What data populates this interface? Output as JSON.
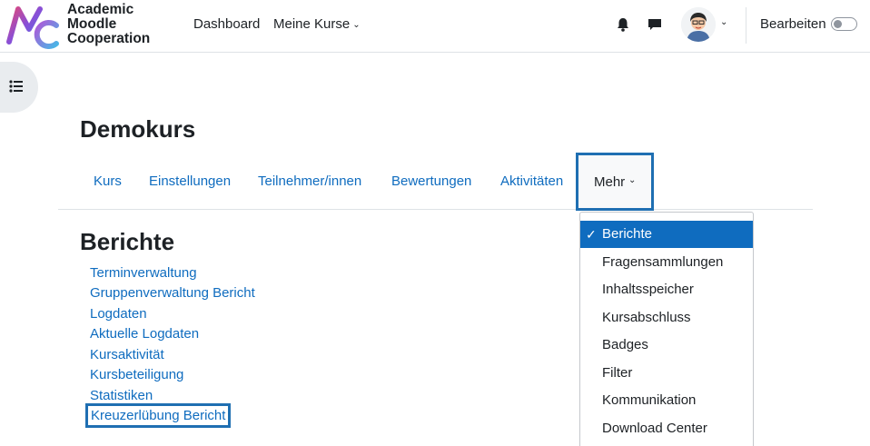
{
  "header": {
    "brand_lines": [
      "Academic",
      "Moodle",
      "Cooperation"
    ],
    "nav": [
      {
        "label": "Dashboard"
      },
      {
        "label": "Meine Kurse",
        "caret": "⌄"
      }
    ],
    "edit_mode_label": "Bearbeiten",
    "edit_mode_on": false
  },
  "course": {
    "title": "Demokurs"
  },
  "tabs": [
    {
      "label": "Kurs"
    },
    {
      "label": "Einstellungen"
    },
    {
      "label": "Teilnehmer/innen"
    },
    {
      "label": "Bewertungen"
    },
    {
      "label": "Aktivitäten"
    }
  ],
  "more_tab": {
    "label": "Mehr",
    "caret": "⌄"
  },
  "section": {
    "title": "Berichte",
    "links": [
      "Terminverwaltung",
      "Gruppenverwaltung Bericht",
      "Logdaten",
      "Aktuelle Logdaten",
      "Kursaktivität",
      "Kursbeteiligung",
      "Statistiken",
      "Kreuzerlübung Bericht"
    ]
  },
  "more_menu": {
    "items": [
      "Berichte",
      "Fragensammlungen",
      "Inhaltsspeicher",
      "Kursabschluss",
      "Badges",
      "Filter",
      "Kommunikation",
      "Download Center"
    ],
    "selected_index": 0,
    "check_glyph": "✓"
  },
  "colors": {
    "link": "#0f6cbf",
    "highlight_border": "#1f6fb2",
    "active_bg": "#0f6cbf"
  }
}
